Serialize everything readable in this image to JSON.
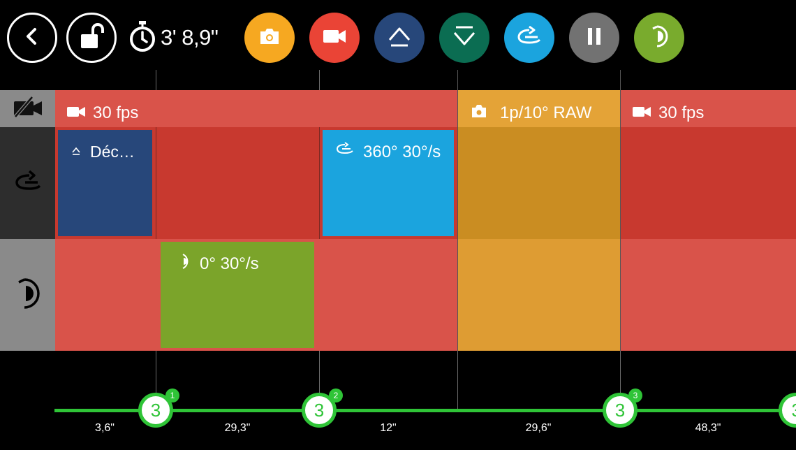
{
  "colors": {
    "video_segment": "#d9534a",
    "photo_segment": "#de9c33",
    "photo_header": "#e4a337",
    "slide_block": "#27477a",
    "pan_block": "#1ba4de",
    "tilt_block": "#7ba42a",
    "timeline": "#2fc437"
  },
  "toolbar": {
    "back_icon": "chevron-left-icon",
    "lock_icon": "unlock-icon",
    "timer_icon": "stopwatch-icon",
    "timer_value": "3' 8,9\"",
    "buttons": [
      {
        "name": "add-photo-button",
        "icon": "camera-icon",
        "color": "#f6a821"
      },
      {
        "name": "add-video-button",
        "icon": "video-camera-icon",
        "color": "#ea4436"
      },
      {
        "name": "add-slide-up-button",
        "icon": "slide-up-icon",
        "color": "#27477a"
      },
      {
        "name": "add-slide-down-button",
        "icon": "slide-down-icon",
        "color": "#0b6d52"
      },
      {
        "name": "add-pan-button",
        "icon": "pan-rotate-icon",
        "color": "#1ba4de"
      },
      {
        "name": "pause-button",
        "icon": "pause-icon",
        "color": "#727272"
      },
      {
        "name": "add-tilt-button",
        "icon": "tilt-icon",
        "color": "#79ab2d"
      }
    ]
  },
  "tracks": {
    "camera": {
      "icon": "camera-off-icon"
    },
    "pan": {
      "icon": "pan-rotate-icon"
    },
    "tilt": {
      "icon": "tilt-icon"
    }
  },
  "segments": [
    {
      "type": "video",
      "label": "30 fps"
    },
    {
      "type": "photo",
      "label": "1p/10° RAW"
    },
    {
      "type": "video",
      "label": "30 fps"
    }
  ],
  "blocks": {
    "slide": {
      "label": "Déc…",
      "icon": "slide-up-icon"
    },
    "pan": {
      "label": "360° 30°/s",
      "icon": "pan-rotate-icon"
    },
    "tilt": {
      "label": "0° 30°/s",
      "icon": "tilt-icon"
    }
  },
  "timeline": {
    "keyframes": [
      {
        "value": "3",
        "badge": "1"
      },
      {
        "value": "3",
        "badge": "2"
      },
      {
        "value": "3",
        "badge": "3"
      },
      {
        "value": "3",
        "badge": ""
      }
    ],
    "durations": [
      "3,6\"",
      "29,3\"",
      "12\"",
      "29,6\"",
      "48,3\""
    ]
  }
}
